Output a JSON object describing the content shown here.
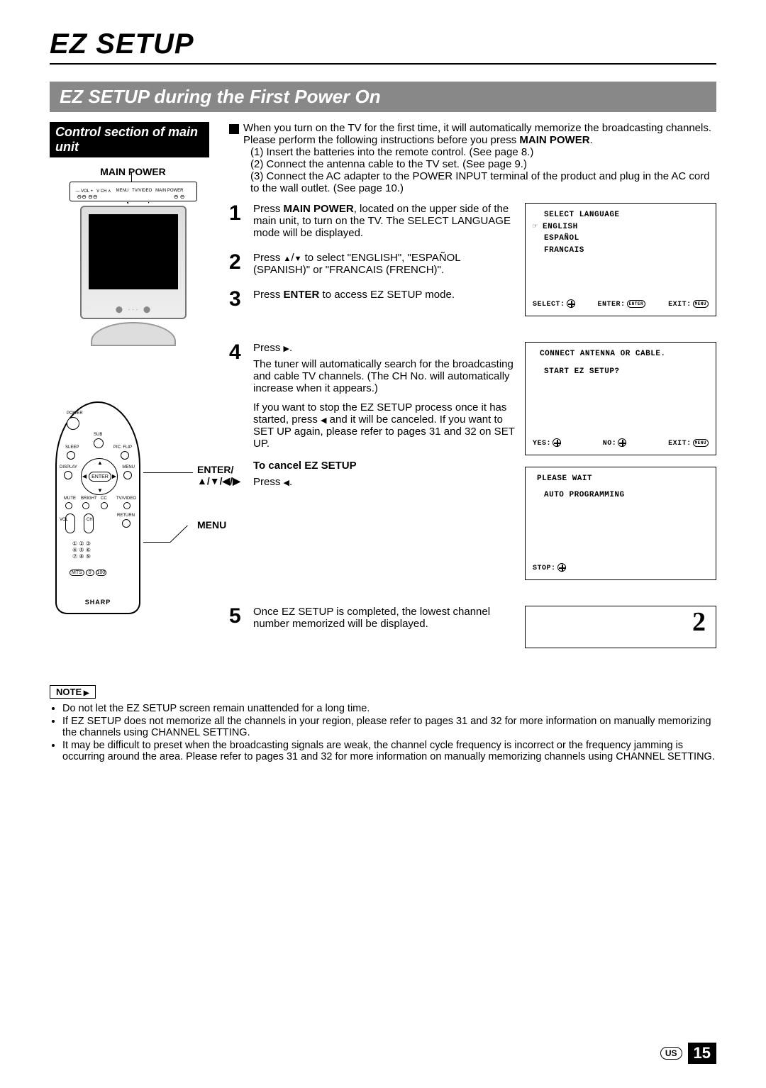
{
  "page": {
    "title": "EZ SETUP",
    "section_heading": "EZ SETUP during the First Power On",
    "region": "US",
    "number": "15"
  },
  "left": {
    "control_label": "Control section of main unit",
    "main_power": "MAIN POWER",
    "remote": {
      "enter_label": "ENTER/",
      "arrows_label": "▲/▼/◀/▶",
      "menu_label": "MENU",
      "brand": "SHARP",
      "btns": {
        "power": "POWER",
        "sub": "SUB",
        "sleep": "SLEEP",
        "picflip": "PIC. FLIP",
        "display": "DISPLAY",
        "enter": "ENTER",
        "menu": "MENU",
        "mute": "MUTE",
        "bright": "BRIGHT",
        "cc": "CC",
        "tvvideo": "TV/VIDEO",
        "vol": "VOL",
        "ch": "CH",
        "return": "RETURN",
        "mts": "MTS"
      }
    }
  },
  "intro": {
    "line1": "When you turn on the TV for the first time, it will automatically memorize the broadcasting channels.",
    "line2a": "Please perform the following instructions before you press ",
    "line2b": "MAIN POWER",
    "line2c": ".",
    "sub1": "(1) Insert the batteries into the remote control. (See page 8.)",
    "sub2": "(2) Connect the antenna cable to the TV set. (See page 9.)",
    "sub3": "(3) Connect the AC adapter to the POWER INPUT terminal of the product and plug in the AC cord to the wall outlet. (See page 10.)"
  },
  "steps": {
    "n1": "1",
    "t1a": "Press ",
    "t1b": "MAIN POWER",
    "t1c": ", located on the upper side of the main unit, to turn on the TV. The SELECT LANGUAGE mode will be displayed.",
    "n2": "2",
    "t2a": "Press ",
    "t2b": " to select \"ENGLISH\", \"ESPAÑOL (SPANISH)\" or \"FRANCAIS (FRENCH)\".",
    "n3": "3",
    "t3a": "Press ",
    "t3b": "ENTER",
    "t3c": " to access EZ SETUP mode.",
    "n4": "4",
    "t4a": "Press ",
    "t4b": ".",
    "t4c": "The tuner will automatically search for the broadcasting and cable TV channels.  (The CH No. will automatically increase when it appears.)",
    "t4d": "If you want to stop the EZ SETUP process once it has started, press ",
    "t4e": " and it will be canceled. If you want to SET UP again, please refer to pages 31 and 32 on SET UP.",
    "cancel_h": "To cancel EZ SETUP",
    "cancel_t1": "Press ",
    "cancel_t2": ".",
    "n5": "5",
    "t5": "Once EZ SETUP is completed, the lowest channel number memorized will be displayed."
  },
  "osd": {
    "lang": {
      "title": "SELECT LANGUAGE",
      "opt1": "ENGLISH",
      "opt2": "ESPAÑOL",
      "opt3": "FRANCAIS",
      "f1": "SELECT:",
      "f2": "ENTER:",
      "f2pill": "ENTER",
      "f3": "EXIT:",
      "f3pill": "MENU"
    },
    "connect": {
      "l1": "CONNECT ANTENNA OR CABLE.",
      "l2": "START EZ SETUP?",
      "f1": "YES:",
      "f2": "NO:",
      "f3": "EXIT:",
      "f3pill": "MENU"
    },
    "wait": {
      "l1": "PLEASE WAIT",
      "l2": "AUTO PROGRAMMING",
      "f1": "STOP:"
    },
    "result": "2"
  },
  "note": {
    "label": "NOTE",
    "b1": "Do not let the EZ SETUP screen remain unattended for a long time.",
    "b2": "If EZ SETUP does not memorize all the channels in your region, please refer to pages 31 and 32 for more information on manually memorizing the channels using CHANNEL SETTING.",
    "b3": "It may be difficult to preset when the broadcasting signals are weak, the channel cycle frequency is incorrect or the frequency jamming is occurring around the area.  Please refer to pages 31 and 32 for more information on manually memorizing channels using CHANNEL SETTING."
  }
}
